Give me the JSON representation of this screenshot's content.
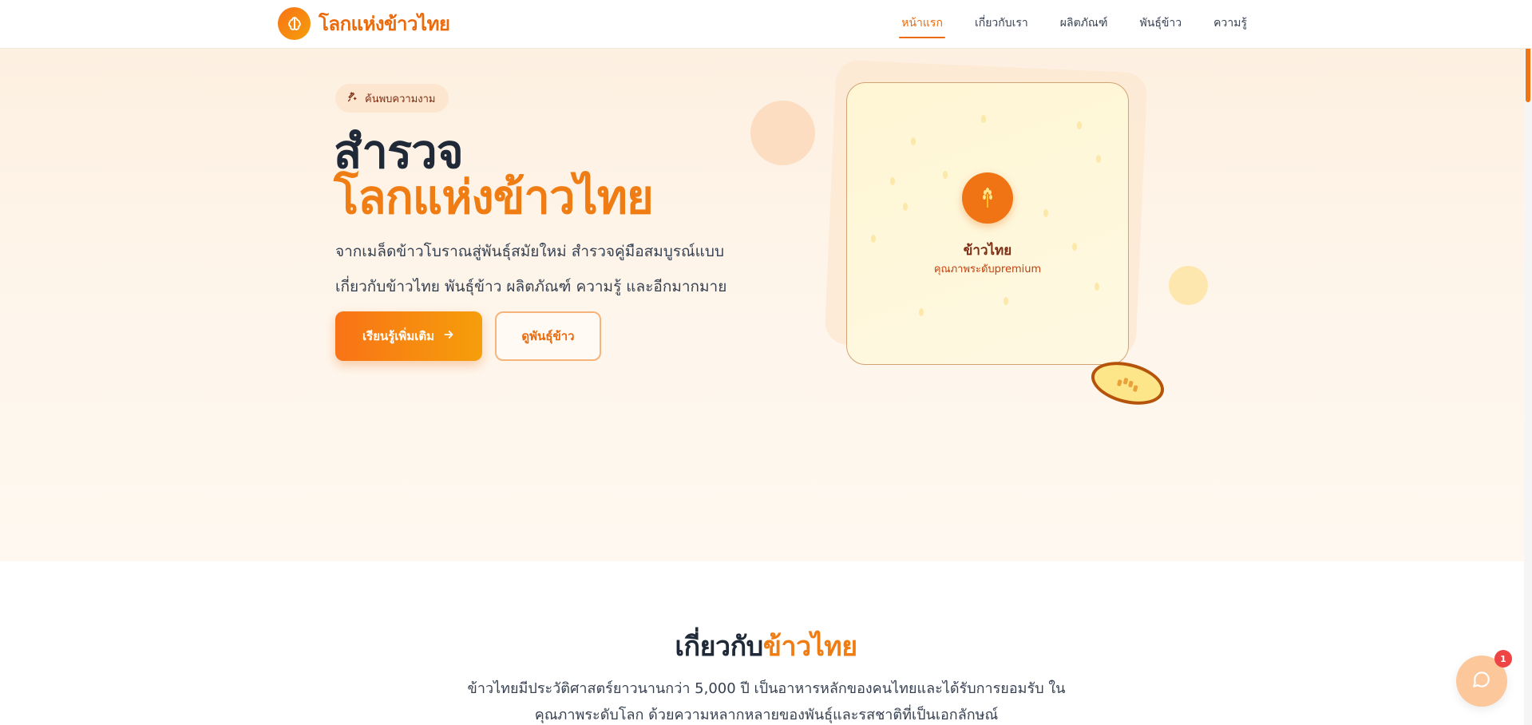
{
  "brand": {
    "logo_icon": "brain-icon",
    "name": "โลกแห่งข้าวไทย",
    "accent_color": "#f07d14"
  },
  "nav": {
    "items": [
      {
        "label": "หน้าแรก",
        "active": true
      },
      {
        "label": "เกี่ยวกับเรา",
        "active": false
      },
      {
        "label": "ผลิตภัณฑ์",
        "active": false
      },
      {
        "label": "พันธุ์ข้าว",
        "active": false
      },
      {
        "label": "ความรู้",
        "active": false
      }
    ]
  },
  "hero": {
    "badge_icon": "sparkle-icon",
    "badge_label": "ค้นพบความงาม",
    "title_line1": "สำรวจ",
    "title_line2": "โลกแห่งข้าวไทย",
    "description": "จากเมล็ดข้าวโบราณสู่พันธุ์สมัยใหม่ สำรวจคู่มือสมบูรณ์แบบเกี่ยวกับข้าวไทย พันธุ์ข้าว ผลิตภัณฑ์ ความรู้ และอีกมากมาย",
    "primary_button": "เรียนรู้เพิ่มเติม",
    "secondary_button": "ดูพันธุ์ข้าว",
    "card": {
      "icon": "rice-stalk-icon",
      "title": "ข้าวไทย",
      "subtitle": "คุณภาพระดับpremium"
    }
  },
  "about": {
    "title_prefix": "เกี่ยวกับ",
    "title_accent": "ข้าวไทย",
    "text": "ข้าวไทยมีประวัติศาสตร์ยาวนานกว่า 5,000 ปี เป็นอาหารหลักของคนไทยและได้รับการยอมรับ ในคุณภาพระดับโลก ด้วยความหลากหลายของพันธุ์และรสชาติที่เป็นเอกลักษณ์"
  },
  "chat": {
    "icon": "chat-bubble-icon",
    "badge_count": "1"
  }
}
